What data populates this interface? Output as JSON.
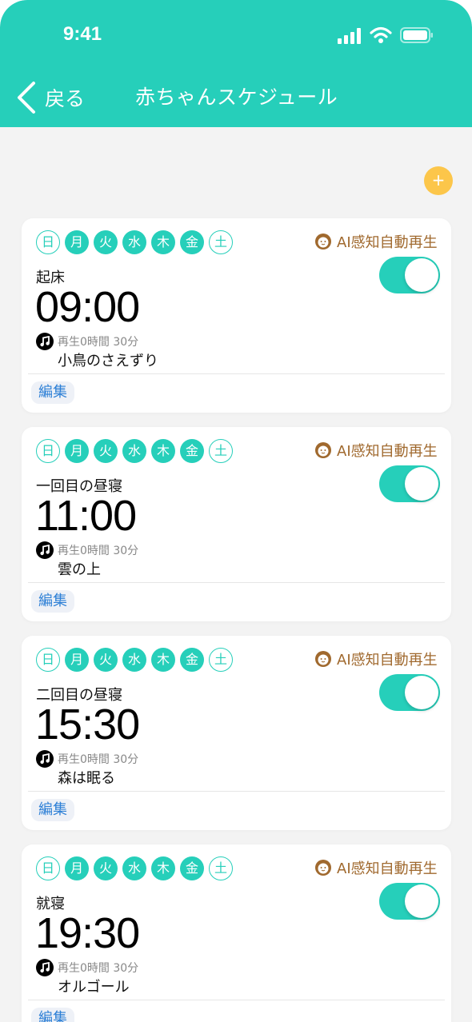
{
  "status_bar": {
    "time": "9:41"
  },
  "nav": {
    "back_label": "戻る",
    "title": "赤ちゃんスケジュール"
  },
  "add_button": {
    "label": "+"
  },
  "colors": {
    "primary": "#26cfba",
    "accent": "#fcc64a",
    "ai": "#a0692e",
    "link": "#2e80d6"
  },
  "days": [
    "日",
    "月",
    "火",
    "水",
    "木",
    "金",
    "土"
  ],
  "schedules": [
    {
      "label": "起床",
      "time": "09:00",
      "duration": "再生0時間 30分",
      "song": "小鳥のさえずり",
      "ai_label": "AI感知自動再生",
      "edit_label": "編集",
      "enabled": true
    },
    {
      "label": "一回目の昼寝",
      "time": "11:00",
      "duration": "再生0時間 30分",
      "song": "雲の上",
      "ai_label": "AI感知自動再生",
      "edit_label": "編集",
      "enabled": true
    },
    {
      "label": "二回目の昼寝",
      "time": "15:30",
      "duration": "再生0時間 30分",
      "song": "森は眠る",
      "ai_label": "AI感知自動再生",
      "edit_label": "編集",
      "enabled": true
    },
    {
      "label": "就寝",
      "time": "19:30",
      "duration": "再生0時間 30分",
      "song": "オルゴール",
      "ai_label": "AI感知自動再生",
      "edit_label": "編集",
      "enabled": true
    }
  ]
}
